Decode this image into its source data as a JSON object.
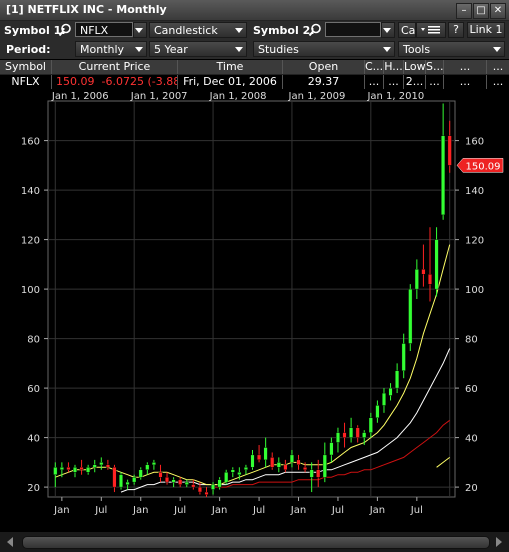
{
  "window": {
    "title": "[1] NETFLIX INC - Monthly",
    "buttons": [
      "–",
      "□",
      "✕"
    ]
  },
  "toolbar1": {
    "symbol1_label": "Symbol 1:",
    "symbol1_value": "NFLX",
    "chart_type": "Candlestick",
    "symbol2_label": "Symbol 2:",
    "symbol2_value": "",
    "ca_label": "Ca",
    "help_label": "?",
    "link_label": "Link 1"
  },
  "toolbar2": {
    "period_label": "Period:",
    "period_value": "Monthly",
    "range_value": "5 Year",
    "studies_label": "Studies",
    "tools_label": "Tools"
  },
  "quote_table": {
    "headers": [
      "Symbol",
      "Current Price",
      "Time",
      "Open",
      "C...",
      "H...",
      "Low",
      "S...",
      "...",
      "..."
    ],
    "row": {
      "symbol": "NFLX",
      "price": "150.09",
      "change": "-6.0725 (-3.88...",
      "time": "Fri, Dec 01, 2006",
      "open": "29.37",
      "c": "...",
      "h": "...",
      "low": "2...",
      "s": "...",
      "e1": "...",
      "e2": "..."
    }
  },
  "colors": {
    "up": "#33ff33",
    "down": "#ff2222",
    "ma_short": "#ffff66",
    "ma_mid": "#ffffff",
    "ma_long": "#cc1111",
    "price_tag": "#ee2222"
  },
  "chart_data": {
    "type": "candlestick",
    "top_axis_labels": [
      "Jan 1, 2006",
      "Jan 1, 2007",
      "Jan 1, 2008",
      "Jan 1, 2009",
      "Jan 1, 2010"
    ],
    "bottom_axis_labels": [
      "Jan",
      "Jul",
      "Jan",
      "Jul",
      "Jan",
      "Jul",
      "Jan",
      "Jul",
      "Jan",
      "Jul"
    ],
    "y_ticks": [
      20,
      40,
      60,
      80,
      100,
      120,
      140,
      160
    ],
    "ylim": [
      16,
      176
    ],
    "last_price_label": "150.09",
    "grid": true,
    "candles": [
      {
        "date": "2006-01",
        "o": 25,
        "h": 30,
        "l": 20,
        "c": 28
      },
      {
        "date": "2006-02",
        "o": 27,
        "h": 30,
        "l": 24,
        "c": 28
      },
      {
        "date": "2006-03",
        "o": 28,
        "h": 30,
        "l": 26,
        "c": 27
      },
      {
        "date": "2006-04",
        "o": 26,
        "h": 29,
        "l": 24,
        "c": 28
      },
      {
        "date": "2006-05",
        "o": 28,
        "h": 31,
        "l": 25,
        "c": 27
      },
      {
        "date": "2006-06",
        "o": 26,
        "h": 29,
        "l": 25,
        "c": 28
      },
      {
        "date": "2006-07",
        "o": 28,
        "h": 31,
        "l": 26,
        "c": 29
      },
      {
        "date": "2006-08",
        "o": 29,
        "h": 32,
        "l": 27,
        "c": 30
      },
      {
        "date": "2006-09",
        "o": 29,
        "h": 31,
        "l": 27,
        "c": 28
      },
      {
        "date": "2006-10",
        "o": 28,
        "h": 29,
        "l": 18,
        "c": 20
      },
      {
        "date": "2006-11",
        "o": 20,
        "h": 26,
        "l": 19,
        "c": 25
      },
      {
        "date": "2006-12",
        "o": 21,
        "h": 23,
        "l": 19,
        "c": 22
      },
      {
        "date": "2007-01",
        "o": 22,
        "h": 25,
        "l": 21,
        "c": 24
      },
      {
        "date": "2007-02",
        "o": 24,
        "h": 28,
        "l": 23,
        "c": 27
      },
      {
        "date": "2007-03",
        "o": 27,
        "h": 30,
        "l": 25,
        "c": 29
      },
      {
        "date": "2007-04",
        "o": 29,
        "h": 31,
        "l": 27,
        "c": 30
      },
      {
        "date": "2007-05",
        "o": 26,
        "h": 29,
        "l": 22,
        "c": 24
      },
      {
        "date": "2007-06",
        "o": 24,
        "h": 26,
        "l": 21,
        "c": 22
      },
      {
        "date": "2007-07",
        "o": 22,
        "h": 24,
        "l": 20,
        "c": 23
      },
      {
        "date": "2007-08",
        "o": 23,
        "h": 24,
        "l": 20,
        "c": 21
      },
      {
        "date": "2007-09",
        "o": 21,
        "h": 23,
        "l": 20,
        "c": 22
      },
      {
        "date": "2007-10",
        "o": 21,
        "h": 23,
        "l": 19,
        "c": 20
      },
      {
        "date": "2007-11",
        "o": 20,
        "h": 22,
        "l": 17,
        "c": 18
      },
      {
        "date": "2007-12",
        "o": 18,
        "h": 20,
        "l": 16,
        "c": 17
      },
      {
        "date": "2008-01",
        "o": 19,
        "h": 22,
        "l": 17,
        "c": 21
      },
      {
        "date": "2008-02",
        "o": 20,
        "h": 24,
        "l": 19,
        "c": 23
      },
      {
        "date": "2008-03",
        "o": 22,
        "h": 27,
        "l": 21,
        "c": 26
      },
      {
        "date": "2008-04",
        "o": 26,
        "h": 28,
        "l": 24,
        "c": 27
      },
      {
        "date": "2008-05",
        "o": 25,
        "h": 28,
        "l": 23,
        "c": 26
      },
      {
        "date": "2008-06",
        "o": 27,
        "h": 29,
        "l": 25,
        "c": 28
      },
      {
        "date": "2008-07",
        "o": 28,
        "h": 35,
        "l": 27,
        "c": 33
      },
      {
        "date": "2008-08",
        "o": 33,
        "h": 37,
        "l": 30,
        "c": 31
      },
      {
        "date": "2008-09",
        "o": 31,
        "h": 40,
        "l": 28,
        "c": 36
      },
      {
        "date": "2008-10",
        "o": 32,
        "h": 34,
        "l": 27,
        "c": 28
      },
      {
        "date": "2008-11",
        "o": 28,
        "h": 32,
        "l": 26,
        "c": 30
      },
      {
        "date": "2008-12",
        "o": 29,
        "h": 31,
        "l": 26,
        "c": 27
      },
      {
        "date": "2009-01",
        "o": 30,
        "h": 35,
        "l": 28,
        "c": 33
      },
      {
        "date": "2009-02",
        "o": 31,
        "h": 33,
        "l": 27,
        "c": 29
      },
      {
        "date": "2009-03",
        "o": 28,
        "h": 30,
        "l": 26,
        "c": 27
      },
      {
        "date": "2009-04",
        "o": 24,
        "h": 30,
        "l": 18,
        "c": 27
      },
      {
        "date": "2009-05",
        "o": 27,
        "h": 31,
        "l": 20,
        "c": 24
      },
      {
        "date": "2009-06",
        "o": 24,
        "h": 38,
        "l": 22,
        "c": 33
      },
      {
        "date": "2009-07",
        "o": 33,
        "h": 40,
        "l": 30,
        "c": 38
      },
      {
        "date": "2009-08",
        "o": 38,
        "h": 44,
        "l": 34,
        "c": 42
      },
      {
        "date": "2009-09",
        "o": 42,
        "h": 46,
        "l": 36,
        "c": 40
      },
      {
        "date": "2009-10",
        "o": 40,
        "h": 48,
        "l": 38,
        "c": 44
      },
      {
        "date": "2009-11",
        "o": 44,
        "h": 45,
        "l": 38,
        "c": 40
      },
      {
        "date": "2009-12",
        "o": 40,
        "h": 43,
        "l": 37,
        "c": 42
      },
      {
        "date": "2010-01",
        "o": 42,
        "h": 50,
        "l": 40,
        "c": 48
      },
      {
        "date": "2010-02",
        "o": 48,
        "h": 55,
        "l": 46,
        "c": 53
      },
      {
        "date": "2010-03",
        "o": 53,
        "h": 60,
        "l": 50,
        "c": 58
      },
      {
        "date": "2010-04",
        "o": 57,
        "h": 62,
        "l": 55,
        "c": 60
      },
      {
        "date": "2010-05",
        "o": 60,
        "h": 70,
        "l": 58,
        "c": 67
      },
      {
        "date": "2010-06",
        "o": 67,
        "h": 82,
        "l": 64,
        "c": 78
      },
      {
        "date": "2010-07",
        "o": 78,
        "h": 102,
        "l": 75,
        "c": 100
      },
      {
        "date": "2010-08",
        "o": 100,
        "h": 112,
        "l": 96,
        "c": 108
      },
      {
        "date": "2010-09",
        "o": 108,
        "h": 118,
        "l": 101,
        "c": 106
      },
      {
        "date": "2010-10",
        "o": 106,
        "h": 125,
        "l": 95,
        "c": 102
      },
      {
        "date": "2010-11",
        "o": 100,
        "h": 125,
        "l": 97,
        "c": 120
      },
      {
        "date": "2010-12",
        "o": 130,
        "h": 175,
        "l": 128,
        "c": 162
      },
      {
        "date": "2011-01",
        "o": 162,
        "h": 168,
        "l": 147,
        "c": 150
      }
    ],
    "ma_short": [
      24,
      25,
      26,
      27,
      27,
      27,
      28,
      28,
      28,
      27,
      26,
      25,
      24,
      24,
      25,
      26,
      26,
      26,
      25,
      24,
      23,
      23,
      22,
      21,
      21,
      21,
      22,
      23,
      24,
      25,
      26,
      27,
      28,
      29,
      29,
      29,
      30,
      30,
      29,
      29,
      29,
      29,
      30,
      32,
      34,
      36,
      37,
      38,
      40,
      42,
      45,
      49,
      53,
      58,
      64,
      72,
      82,
      90,
      98,
      108,
      118
    ],
    "ma_mid": [
      null,
      null,
      null,
      null,
      null,
      null,
      null,
      null,
      null,
      null,
      18,
      19,
      19,
      20,
      21,
      21,
      22,
      22,
      22,
      22,
      22,
      22,
      21,
      21,
      21,
      21,
      21,
      22,
      22,
      23,
      23,
      24,
      25,
      25,
      25,
      26,
      26,
      26,
      26,
      26,
      26,
      27,
      27,
      28,
      29,
      30,
      31,
      32,
      33,
      34,
      36,
      38,
      40,
      43,
      46,
      50,
      55,
      60,
      65,
      70,
      76
    ],
    "ma_long": [
      null,
      null,
      null,
      null,
      null,
      null,
      null,
      null,
      null,
      null,
      null,
      null,
      null,
      null,
      null,
      null,
      null,
      null,
      null,
      null,
      null,
      null,
      null,
      null,
      20,
      20,
      20,
      21,
      21,
      21,
      21,
      22,
      22,
      22,
      22,
      22,
      22,
      23,
      23,
      23,
      23,
      24,
      24,
      25,
      25,
      26,
      26,
      27,
      27,
      28,
      29,
      30,
      31,
      32,
      34,
      36,
      38,
      40,
      42,
      45,
      47
    ],
    "ma_xlong": [
      null,
      null,
      null,
      null,
      null,
      null,
      null,
      null,
      null,
      null,
      null,
      null,
      null,
      null,
      null,
      null,
      null,
      null,
      null,
      null,
      null,
      null,
      null,
      null,
      null,
      null,
      null,
      null,
      null,
      null,
      null,
      null,
      null,
      null,
      null,
      null,
      null,
      null,
      null,
      null,
      null,
      null,
      null,
      null,
      null,
      null,
      null,
      null,
      null,
      null,
      null,
      null,
      null,
      null,
      null,
      null,
      null,
      null,
      28,
      30,
      32
    ]
  }
}
